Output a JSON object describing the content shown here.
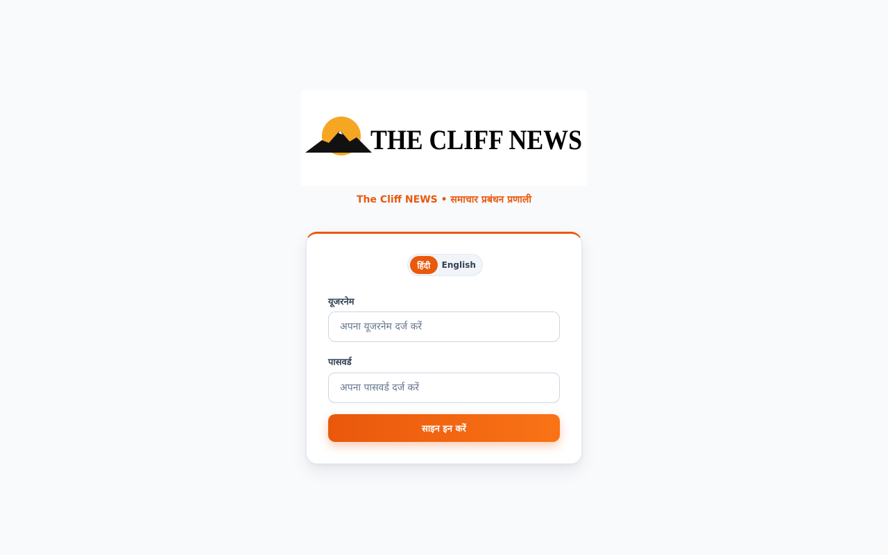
{
  "brand": {
    "logo_text": "THE CLIFF NEWS",
    "tagline": "The Cliff NEWS • समाचार प्रबंधन प्रणाली",
    "accent_color": "#ea580c",
    "sun_color": "#f5a623"
  },
  "language_toggle": {
    "hindi_label": "हिंदी",
    "english_label": "English",
    "selected": "हिंदी"
  },
  "form": {
    "username": {
      "label": "यूजरनेम",
      "placeholder": "अपना यूजरनेम दर्ज करें",
      "value": ""
    },
    "password": {
      "label": "पासवर्ड",
      "placeholder": "अपना पासवर्ड दर्ज करें",
      "value": ""
    },
    "submit_label": "साइन इन करें"
  }
}
